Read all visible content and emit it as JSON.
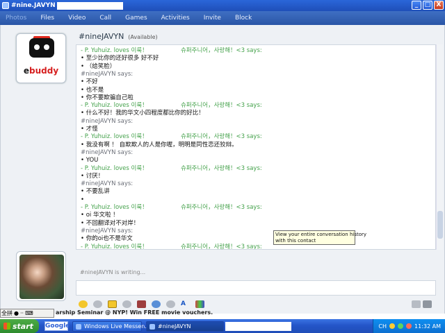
{
  "window": {
    "title": "#nine.JAVYN",
    "buttons": [
      "_",
      "□",
      "X"
    ]
  },
  "menu": [
    {
      "label": "Photos",
      "dim": true
    },
    {
      "label": "Files"
    },
    {
      "label": "Video"
    },
    {
      "label": "Call"
    },
    {
      "label": "Games"
    },
    {
      "label": "Activities"
    },
    {
      "label": "Invite"
    },
    {
      "label": "Block"
    }
  ],
  "logo": {
    "brand_prefix": "e",
    "brand_suffix": "buddy"
  },
  "contact": {
    "name": "#nineJAVYN",
    "status": "(Available)"
  },
  "conversation": [
    {
      "type": "them",
      "text": "- P. Yuhuiz. loves 이룩！",
      "tail": "슈퍼주니어，사랑해！<3 says:"
    },
    {
      "type": "msg",
      "text": "• 至少比你的还好很多   好不好"
    },
    {
      "type": "msg",
      "text": "• （给笑脸）"
    },
    {
      "type": "me",
      "text": "#nineJAVYN says:"
    },
    {
      "type": "msg",
      "text": "• 不好"
    },
    {
      "type": "msg",
      "text": "• 也不是"
    },
    {
      "type": "msg",
      "text": "• 你不要欺骗自己啦"
    },
    {
      "type": "them",
      "text": "- P. Yuhuiz. loves 이룩！",
      "tail": "슈퍼주니어，사랑해！<3 says:"
    },
    {
      "type": "msg",
      "text": "• 什么不好！我的华文小四程度都比你的好比！"
    },
    {
      "type": "me",
      "text": "#nineJAVYN says:"
    },
    {
      "type": "msg",
      "text": "• 才怪"
    },
    {
      "type": "them",
      "text": "- P. Yuhuiz. loves 이룩！",
      "tail": "슈퍼주니어，사랑해！<3 says:"
    },
    {
      "type": "msg",
      "text": "• 我没有啊   ！     自欺欺人的人是你喔，明明是同性恋还狡辩。"
    },
    {
      "type": "me",
      "text": "#nineJAVYN says:"
    },
    {
      "type": "msg",
      "text": "•       YOU"
    },
    {
      "type": "them",
      "text": "- P. Yuhuiz. loves 이룩！",
      "tail": "슈퍼주니어，사랑해！<3 says:"
    },
    {
      "type": "msg",
      "text": "• 讨厌！"
    },
    {
      "type": "me",
      "text": "#nineJAVYN says:"
    },
    {
      "type": "msg",
      "text": "• 不要乱讲"
    },
    {
      "type": "msg",
      "text": "• "
    },
    {
      "type": "them",
      "text": "- P. Yuhuiz. loves 이룩！",
      "tail": "슈퍼주니어，사랑해！<3 says:"
    },
    {
      "type": "msg",
      "text": "• oi 华文啦    ！"
    },
    {
      "type": "msg",
      "text": "• 不回翻译对不对岸！"
    },
    {
      "type": "me",
      "text": "#nineJAVYN says:"
    },
    {
      "type": "msg",
      "text": "• 你的oi也不是华文"
    },
    {
      "type": "them",
      "text": "- P. Yuhuiz. loves 이룩！",
      "tail": "슈퍼주니어，사랑해！<3 says:"
    }
  ],
  "tooltip": {
    "line1": "View your entire conversation history",
    "line2": "with this contact"
  },
  "writing_status": "#nineJAVYN is writing...",
  "ime": {
    "mode": "全拼",
    "items": [
      "●",
      "··",
      "⌨"
    ]
  },
  "ticker": "arship Seminar @ NYP! Win FREE movie vouchers.",
  "taskbar": {
    "start": "start",
    "google": "Google",
    "tasks": [
      {
        "label": "Windows Live Messen..."
      },
      {
        "label": "#nineJAVYN"
      }
    ],
    "clock": "11:32 AM",
    "lang": "CH"
  }
}
